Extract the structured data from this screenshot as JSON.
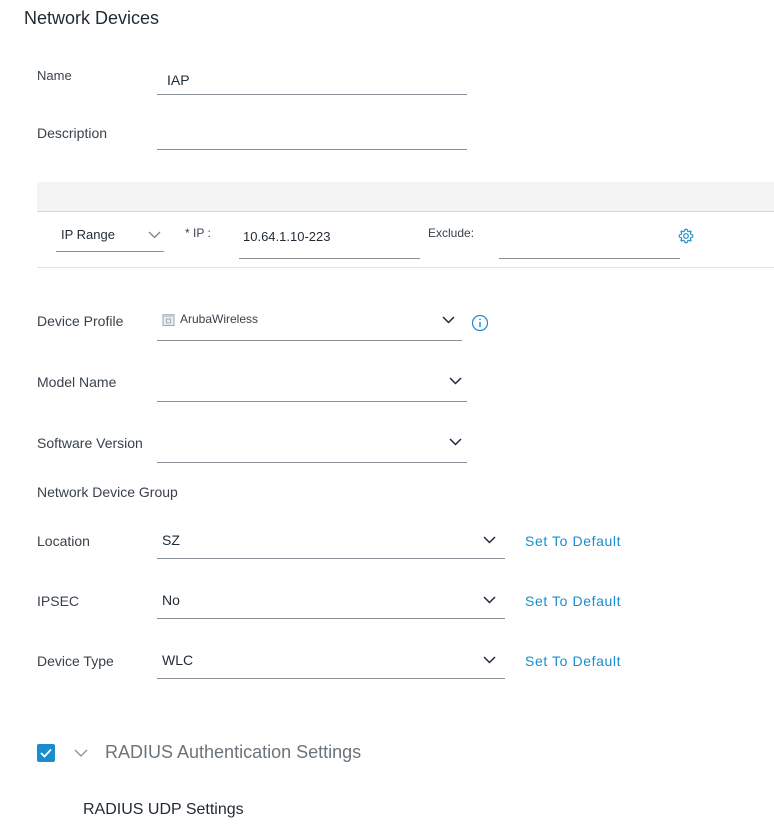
{
  "page": {
    "title": "Network Devices"
  },
  "form": {
    "name": {
      "label": "Name",
      "value": "IAP"
    },
    "description": {
      "label": "Description",
      "value": ""
    },
    "ip": {
      "mode_value": "IP Range",
      "ip_label": "* IP :",
      "ip_value": "10.64.1.10-223",
      "exclude_label": "Exclude:",
      "exclude_value": ""
    },
    "device_profile": {
      "label": "Device Profile",
      "value": "ArubaWireless"
    },
    "model_name": {
      "label": "Model Name",
      "value": ""
    },
    "software_version": {
      "label": "Software Version",
      "value": ""
    },
    "network_device_group": {
      "label": "Network Device Group"
    },
    "location": {
      "label": "Location",
      "value": "SZ",
      "default_link": "Set To Default"
    },
    "ipsec": {
      "label": "IPSEC",
      "value": "No",
      "default_link": "Set To Default"
    },
    "device_type": {
      "label": "Device Type",
      "value": "WLC",
      "default_link": "Set To Default"
    }
  },
  "radius": {
    "checked": true,
    "title": "RADIUS Authentication Settings",
    "udp_title": "RADIUS UDP Settings"
  },
  "colors": {
    "accent": "#1b8ccc",
    "text": "#39424b",
    "band": "#f4f4f4"
  },
  "icons": {
    "chevron": "chevron-down-icon",
    "settings": "gear-icon",
    "info": "info-icon",
    "profile": "device-profile-icon",
    "check": "checkmark-icon"
  }
}
